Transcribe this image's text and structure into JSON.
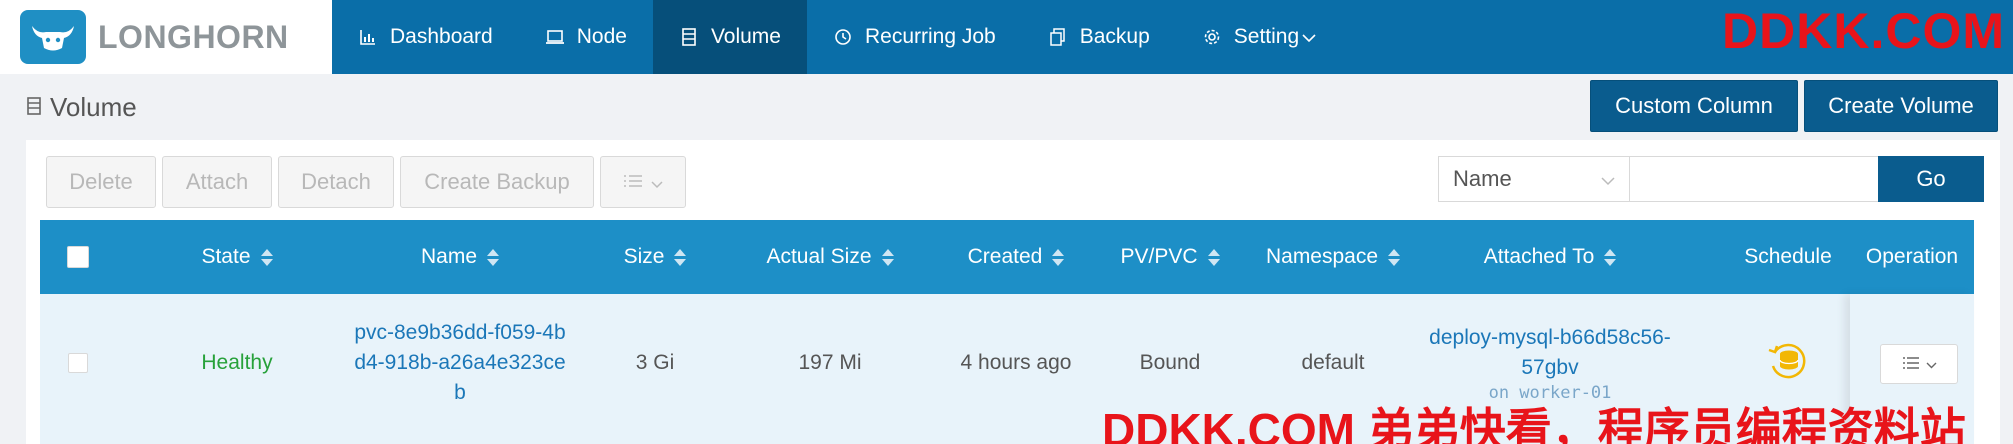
{
  "brand": {
    "name": "LONGHORN"
  },
  "nav": [
    {
      "label": "Dashboard",
      "icon": "bar-chart-icon"
    },
    {
      "label": "Node",
      "icon": "laptop-icon"
    },
    {
      "label": "Volume",
      "icon": "volume-icon",
      "active": true
    },
    {
      "label": "Recurring Job",
      "icon": "clock-icon"
    },
    {
      "label": "Backup",
      "icon": "copy-icon"
    },
    {
      "label": "Setting",
      "icon": "gear-icon"
    }
  ],
  "watermark_top": "DDKK.COM",
  "watermark_bottom": "DDKK.COM 弟弟快看，程序员编程资料站",
  "page": {
    "title": "Volume"
  },
  "header_buttons": {
    "custom_column": "Custom Column",
    "create_volume": "Create Volume"
  },
  "toolbar": {
    "delete": "Delete",
    "attach": "Attach",
    "detach": "Detach",
    "create_backup": "Create Backup"
  },
  "filter": {
    "field": "Name",
    "value": "",
    "go": "Go"
  },
  "table": {
    "columns": [
      "State",
      "Name",
      "Size",
      "Actual Size",
      "Created",
      "PV/PVC",
      "Namespace",
      "Attached To",
      "Schedule",
      "Operation"
    ],
    "rows": [
      {
        "state": "Healthy",
        "name_lines": [
          "pvc-8e9b36dd-f059-4b",
          "d4-918b-a26a4e323ce",
          "b"
        ],
        "size": "3 Gi",
        "actual_size": "197 Mi",
        "created": "4 hours ago",
        "pv_pvc": "Bound",
        "namespace": "default",
        "attached_lines": [
          "deploy-mysql-b66d58c56-",
          "57gbv"
        ],
        "attached_node": "on worker-01"
      }
    ]
  },
  "colors": {
    "nav_bg": "#0a6ea8",
    "nav_active": "#064f7a",
    "table_header": "#1d8fc7",
    "primary_button": "#0a5c8e",
    "healthy": "#27a13a",
    "link": "#1b77b8",
    "watermark": "#e8141a",
    "schedule_icon": "#f2b705"
  }
}
